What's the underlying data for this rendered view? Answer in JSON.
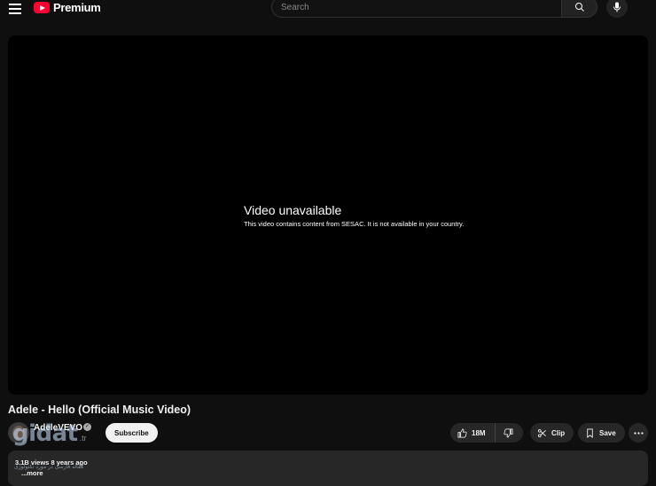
{
  "header": {
    "brand": "Premium",
    "search_placeholder": "Search"
  },
  "player": {
    "error_title": "Video unavailable",
    "error_message": "This video contains content from SESAC. It is not available in your country."
  },
  "video": {
    "title": "Adele - Hello (Official Music Video)",
    "channel_name": "AdeleVEVO",
    "subscribe_label": "Subscribe",
    "like_count": "18M",
    "clip_label": "Clip",
    "save_label": "Save"
  },
  "description": {
    "meta": "3.1B views  8 years ago",
    "more_label": "...more"
  },
  "watermark": {
    "logo": "gidat",
    "tld": ".tr",
    "tagline": "مقاله فارسی در مورد تکنولوژی"
  },
  "colors": {
    "brand_red": "#ff0033",
    "background": "#0f0f0f",
    "pill": "#272727"
  }
}
